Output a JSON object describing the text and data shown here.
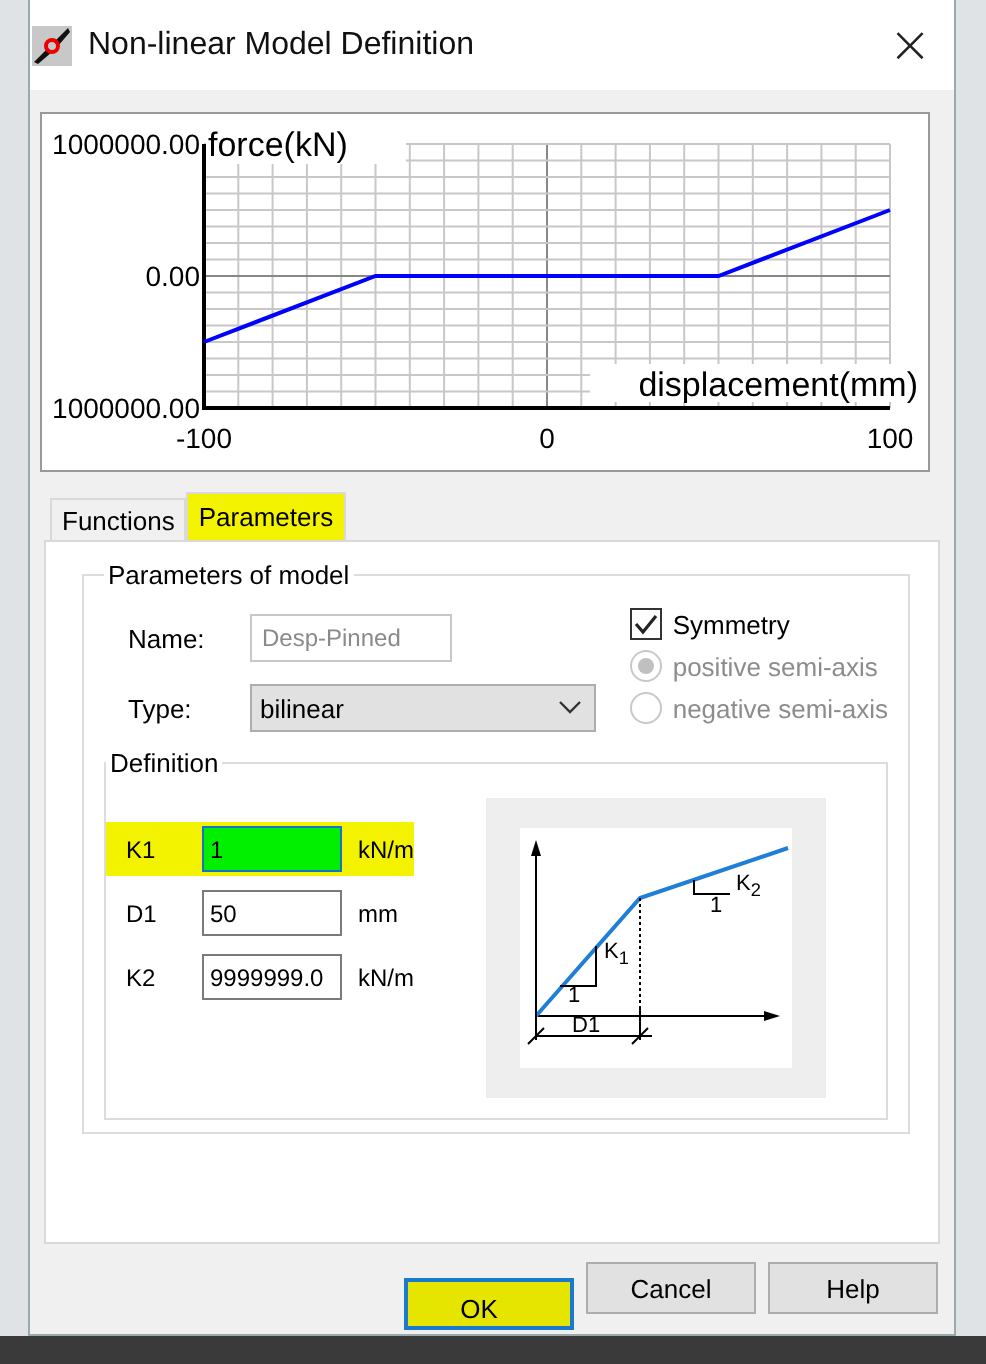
{
  "window": {
    "title": "Non-linear Model Definition",
    "close": "×"
  },
  "chart": {
    "chart_data": {
      "type": "line",
      "xlabel": "displacement(mm)",
      "ylabel": "force(kN)",
      "xlim": [
        -100,
        100
      ],
      "ylim": [
        -1000000,
        1000000
      ],
      "xticks": [
        -100,
        0,
        100
      ],
      "yticks": [
        {
          "value": 1000000,
          "label": "1000000.00"
        },
        {
          "value": 0,
          "label": "0.00"
        },
        {
          "value": -1000000,
          "label": "1000000.00"
        }
      ],
      "series": [
        {
          "color": "#0000ff",
          "x": [
            -100,
            -50,
            50,
            100
          ],
          "values": [
            -500000,
            0,
            0,
            500000
          ]
        }
      ]
    }
  },
  "tabs": [
    {
      "label": "Functions",
      "selected": false,
      "highlighted": false
    },
    {
      "label": "Parameters",
      "selected": true,
      "highlighted": true
    }
  ],
  "parameters_group": {
    "title": "Parameters of model",
    "name": {
      "label": "Name:",
      "value": "Desp-Pinned",
      "disabled": true
    },
    "type": {
      "label": "Type:",
      "value": "bilinear"
    },
    "symmetry": {
      "label": "Symmetry",
      "checked": true
    },
    "radios": [
      {
        "label": "positive semi-axis",
        "selected": true,
        "disabled": true
      },
      {
        "label": "negative semi-axis",
        "selected": false,
        "disabled": true
      }
    ]
  },
  "definition": {
    "title": "Definition",
    "rows": [
      {
        "label": "K1",
        "value": "1",
        "unit": "kN/m",
        "focused": true,
        "highlighted": true
      },
      {
        "label": "D1",
        "value": "50",
        "unit": "mm",
        "focused": false,
        "highlighted": false
      },
      {
        "label": "K2",
        "value": "9999999.0",
        "unit": "kN/m",
        "focused": false,
        "highlighted": false
      }
    ],
    "diagram": {
      "k1": "K$_{1}$",
      "k2": "K$_{2}$",
      "one_a": "1",
      "one_b": "1",
      "d1": "D1"
    }
  },
  "buttons": [
    {
      "label": "OK",
      "highlighted": true,
      "default": true
    },
    {
      "label": "Cancel",
      "highlighted": false,
      "default": false
    },
    {
      "label": "Help",
      "highlighted": false,
      "default": false
    }
  ]
}
